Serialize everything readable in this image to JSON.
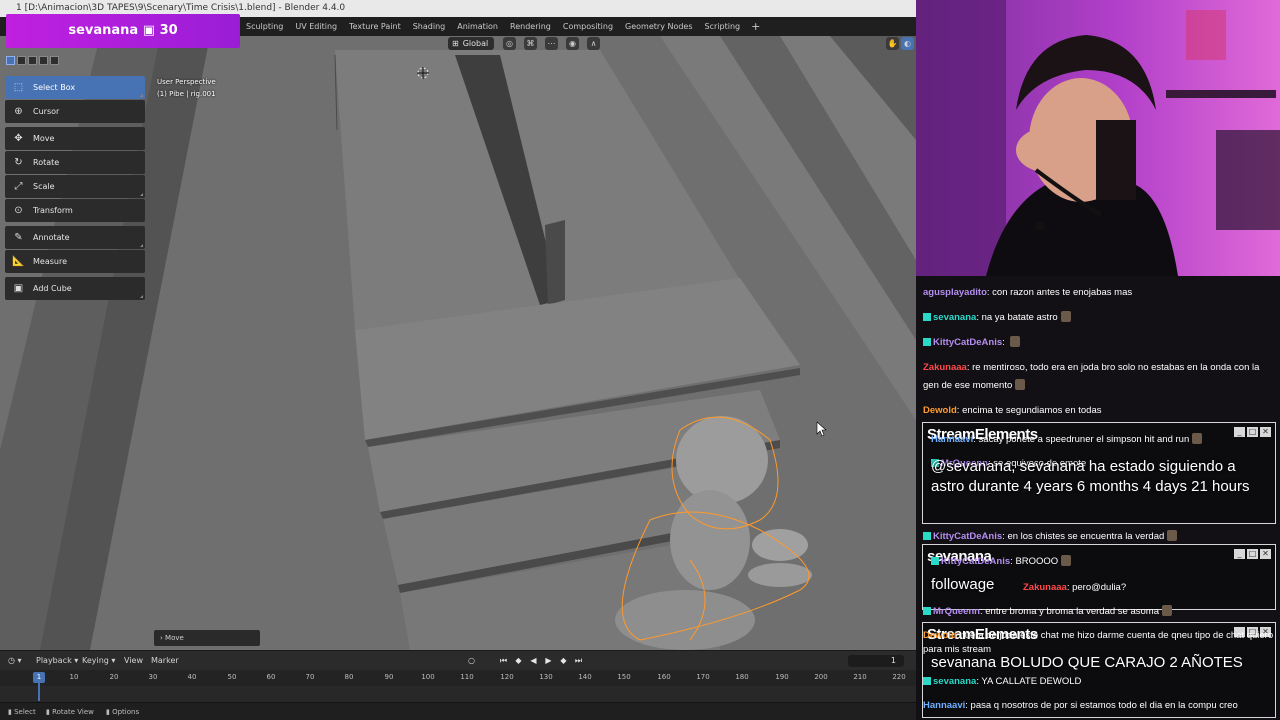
{
  "window": {
    "title": "1 [D:\\Animacion\\3D TAPES\\9\\Scenary\\Time Crisis\\1.blend] - Blender 4.4.0"
  },
  "workspace_tabs": [
    "Sculpting",
    "UV Editing",
    "Texture Paint",
    "Shading",
    "Animation",
    "Rendering",
    "Compositing",
    "Geometry Nodes",
    "Scripting"
  ],
  "workspace_add": "+",
  "viewport_header": {
    "transform_orientation": "Global"
  },
  "toolbar": {
    "tools": [
      {
        "label": "Select Box",
        "icon": "select-box-icon",
        "active": true
      },
      {
        "label": "Cursor",
        "icon": "cursor-icon"
      },
      {
        "label": "Move",
        "icon": "move-icon"
      },
      {
        "label": "Rotate",
        "icon": "rotate-icon"
      },
      {
        "label": "Scale",
        "icon": "scale-icon"
      },
      {
        "label": "Transform",
        "icon": "transform-icon"
      },
      {
        "label": "Annotate",
        "icon": "annotate-icon"
      },
      {
        "label": "Measure",
        "icon": "measure-icon"
      },
      {
        "label": "Add Cube",
        "icon": "add-cube-icon"
      }
    ]
  },
  "viewport_info": {
    "view": "User Perspective",
    "object": "(1) Pibe | rig.001"
  },
  "last_operator": "Move",
  "timeline": {
    "menus": [
      "Playback",
      "Keying",
      "View",
      "Marker"
    ],
    "current_frame": "1",
    "playhead_frame": "1",
    "ticks": [
      "10",
      "20",
      "30",
      "40",
      "50",
      "60",
      "70",
      "80",
      "90",
      "100",
      "110",
      "120",
      "130",
      "140",
      "150",
      "160",
      "170",
      "180",
      "190",
      "200",
      "210",
      "220"
    ]
  },
  "statusbar": {
    "items": [
      "Select",
      "Rotate View",
      "Options"
    ]
  },
  "overlay": {
    "sub_user": "sevanana",
    "sub_icon": "gift-icon",
    "sub_count": "30"
  },
  "chat": {
    "messages": [
      {
        "user": "agusplayadito",
        "text": "con razon antes te enojabas mas",
        "color": "#b48ef0"
      },
      {
        "user": "sevanana",
        "text": "na ya batate astro",
        "color": "#2bd9c9"
      },
      {
        "user": "KittyCatDeAnis",
        "text": "",
        "color": "#b48ef0"
      },
      {
        "user": "Zakunaaa",
        "text": "re mentiroso, todo era en joda bro solo no estabas en la onda con la gen de ese momento",
        "color": "#ff4a4a"
      },
      {
        "user": "Dewold",
        "text": "encima te segundiamos en todas",
        "color": "#ff9b2e"
      },
      {
        "user": "Hannaavi",
        "text": "sacay ponete a speedruner el simpson hit and run",
        "color": "#6fb0ff"
      },
      {
        "user": "MrQueenn",
        "text": "se equivoco de emote",
        "color": "#b48ef0"
      },
      {
        "user": "KittyCatDeAnis",
        "text": "en los chistes se encuentra la verdad",
        "color": "#b48ef0"
      },
      {
        "user": "KittyCatDeAnis",
        "text": "BROOOO",
        "color": "#b48ef0"
      },
      {
        "user": "Zakunaaa",
        "text": "pero@dulia?",
        "color": "#ff4a4a"
      },
      {
        "user": "MrQueenn",
        "text": "entre broma y broma la verdad se asoma",
        "color": "#b48ef0"
      },
      {
        "user": "Dewold",
        "text": "fuera de joda este chat me hizo darme cuenta de qneu tipo de chat quiero para mis stream",
        "color": "#ff9b2e"
      },
      {
        "user": "sevanana",
        "text": "YA CALLATE DEWOLD",
        "color": "#2bd9c9"
      },
      {
        "user": "Hannaavi",
        "text": "pasa q nosotros de por si estamos todo el dia en la compu creo",
        "color": "#6fb0ff"
      }
    ]
  },
  "streamelements": [
    {
      "title": "StreamElements",
      "alert": "@sevanana, sevanana ha estado siguiendo a astro durante 4 years 6 months 4 days 21 hours"
    },
    {
      "title": "sevanana",
      "alert": "followage"
    },
    {
      "title": "StreamElements",
      "alert": "sevanana BOLUDO QUE CARAJO 2 AÑOTES"
    }
  ]
}
